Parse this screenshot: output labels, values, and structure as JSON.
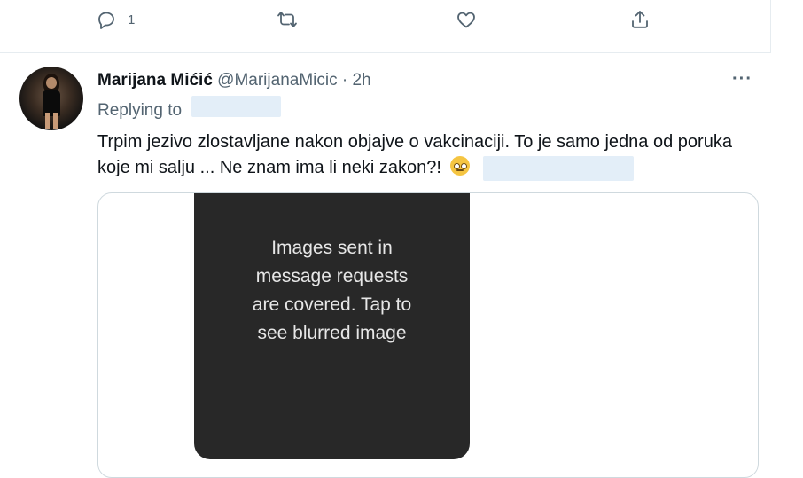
{
  "action_bar": {
    "reply_count": "1",
    "retweet_count": "",
    "like_count": ""
  },
  "tweet": {
    "display_name": "Marijana Mićić",
    "handle": "@MarijanaMicic",
    "separator": " · ",
    "time": "2h",
    "more_label": "···",
    "replying_to_label": "Replying to",
    "text": "Trpim jezivo zlostavljane nakon objajve o vakcinaciji. To je samo jedna od poruka koje mi salju  ... Ne znam ima li neki zakon?!",
    "emoji": "face-with-rolling-eyes"
  },
  "media": {
    "covered_text_lines": [
      "Images sent in",
      "message requests",
      "are covered. Tap to",
      "see blurred image"
    ]
  },
  "colors": {
    "text": "#0f1419",
    "muted": "#536471",
    "redaction": "#e3eef8",
    "media_bg": "#282828",
    "border": "#cfd9de"
  }
}
